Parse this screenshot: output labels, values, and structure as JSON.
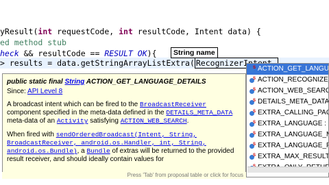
{
  "code": {
    "line1": {
      "pre": "yResult(",
      "kw1": "int",
      "mid1": " requestCode, ",
      "kw2": "int",
      "mid2": " resultCode, Intent data) {"
    },
    "line2": "ed method stub",
    "line3": {
      "a": "heck",
      "b": " && resultCode == ",
      "c": "RESULT_OK",
      "d": "){"
    },
    "line4": {
      "a": "> results = data.getStringArrayListExtra(",
      "b": "RecognizerIntent.",
      "c": ""
    }
  },
  "tooltip_label": "String name",
  "javadoc": {
    "sig_prefix": "public static final ",
    "sig_type": "String",
    "sig_name": " ACTION_GET_LANGUAGE_DETAILS",
    "since_label": "Since: ",
    "since_value": "API Level 8",
    "p1_a": "A broadcast intent which can be fired to the ",
    "p1_link1": "BroadcastReceiver",
    "p1_b": " component specified in the meta-data defined in the ",
    "p1_link2": "DETAILS_META_DATA",
    "p1_c": " meta-data of an ",
    "p1_link3": "Activity",
    "p1_d": " satisfying ",
    "p1_link4": "ACTION_WEB_SEARCH",
    "p1_e": ".",
    "p2_a": "When fired with ",
    "p2_link1": "sendOrderedBroadcast(Intent, String, BroadcastReceiver, android.os.Handler, int, String, android.os.Bundle)",
    "p2_b": ", a ",
    "p2_link2": "Bundle",
    "p2_c": " of extras will be returned to the provided result receiver, and should ideally contain values for"
  },
  "status_text": "Press 'Tab' from proposal table or click for focus",
  "proposals": [
    "ACTION_GET_LANGUAGE_DETAILS",
    "ACTION_RECOGNIZE_SPEECH",
    "ACTION_WEB_SEARCH",
    "DETAILS_META_DATA",
    "EXTRA_CALLING_PACKAGE",
    "EXTRA_LANGUAGE : String",
    "EXTRA_LANGUAGE_MODEL",
    "EXTRA_LANGUAGE_PREFERENCE",
    "EXTRA_MAX_RESULTS : String",
    "EXTRA_ONLY_RETURN_LANGUAGE_PREFERENCE"
  ],
  "proposals_display": [
    "ACTION_GET_LANGUAG",
    "ACTION_RECOGNIZE_S",
    "ACTION_WEB_SEARCH",
    "DETAILS_META_DATA :",
    "EXTRA_CALLING_PACKA",
    "EXTRA_LANGUAGE : St",
    "EXTRA_LANGUAGE_MO",
    "EXTRA_LANGUAGE_PRE",
    "EXTRA_MAX_RESULTS :",
    "EXTRA_ONLY_RETURN_"
  ],
  "colors": {
    "selection": "#3875d7",
    "javadoc_bg": "#ffffe1",
    "keyword": "#7f0055",
    "comment": "#3f7f5f"
  }
}
